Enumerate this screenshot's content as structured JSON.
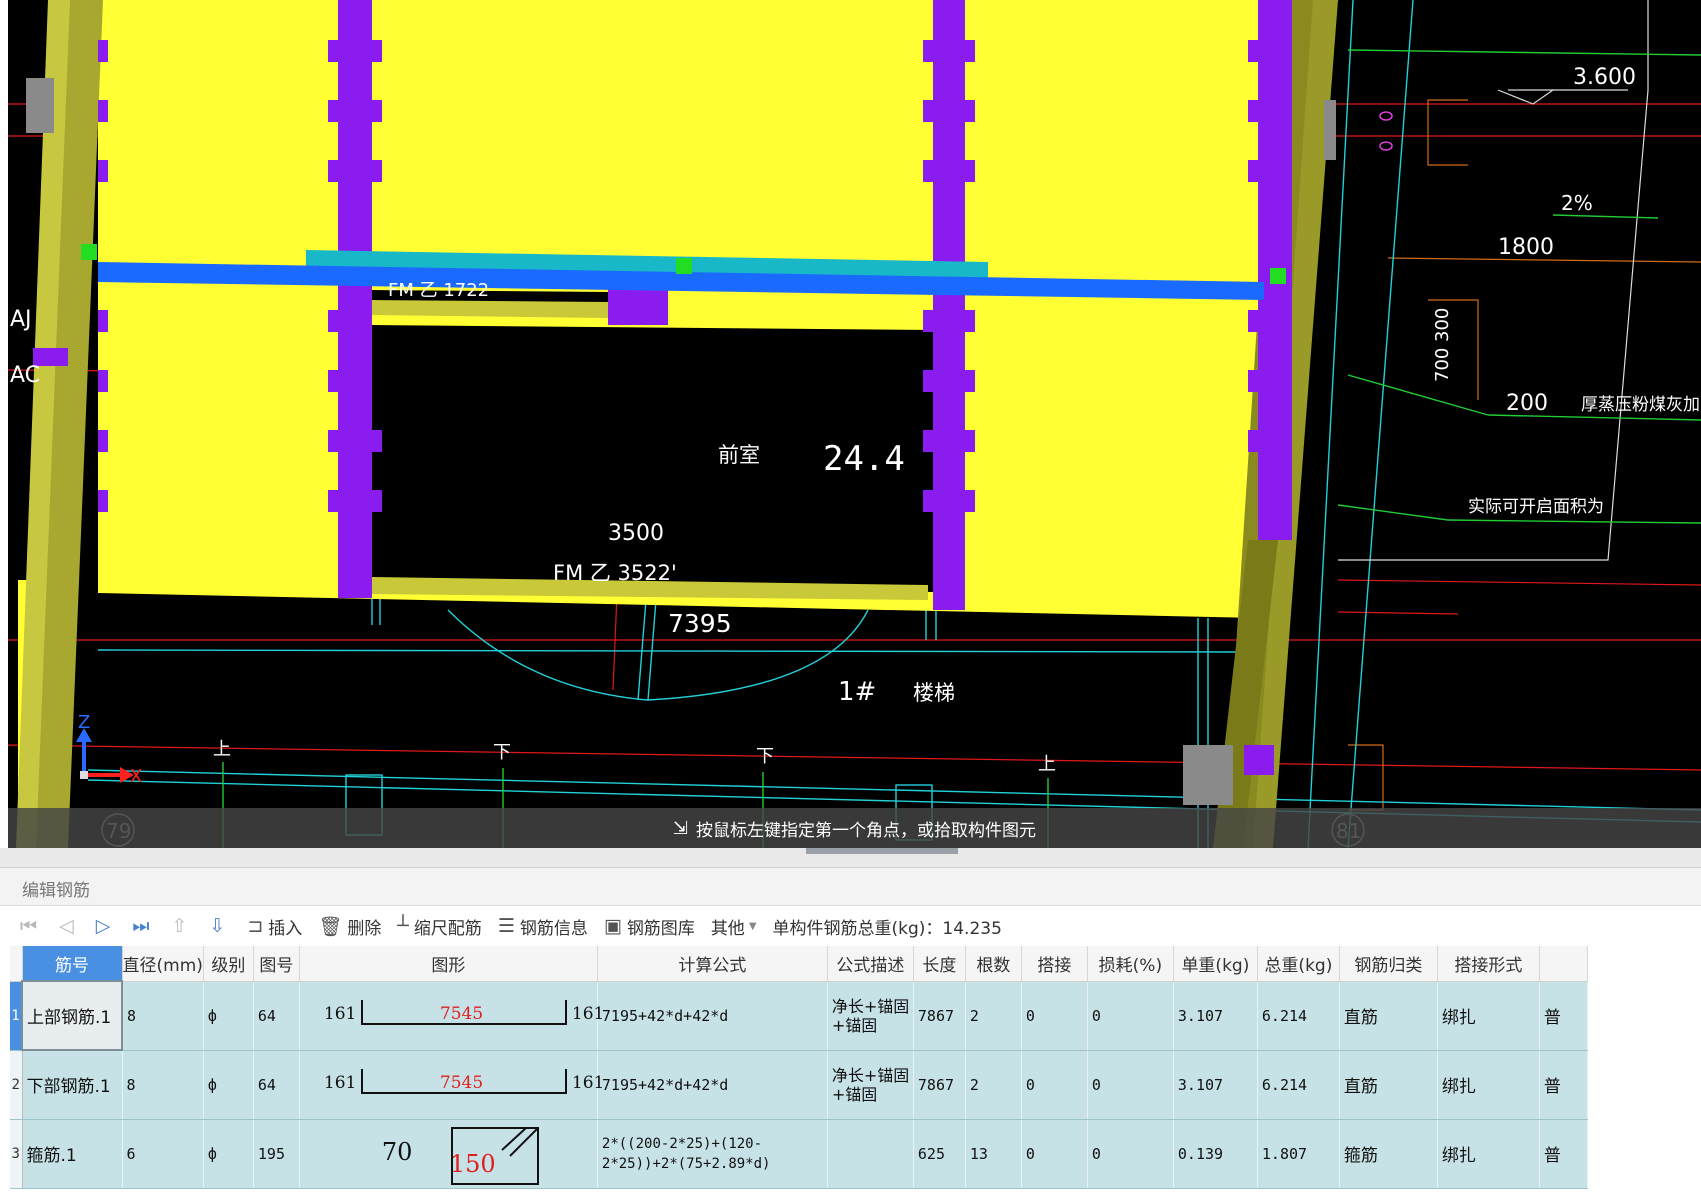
{
  "canvas": {
    "labels": {
      "room": "前室",
      "area": "24.4",
      "dim_3500": "3500",
      "door_upper": "FM 乙 1722",
      "door_lower": "FM 乙 3522'",
      "dim_7395": "7395",
      "stair": "1#",
      "stair_name": "楼梯",
      "elev": "3.600",
      "slope": "2%",
      "dim_1800": "1800",
      "dim_300": "300",
      "dim_700": "700",
      "dim_200": "200",
      "wall_note": "厚蒸压粉煤灰加",
      "open_note": "实际可开启面积为",
      "axis_a": "AJ",
      "axis_b": "AC",
      "up1": "上",
      "down1": "下",
      "down2": "下",
      "up2": "上",
      "grid79": "79",
      "grid81": "81",
      "axis_z": "Z",
      "axis_x": "X"
    },
    "status_text": "按鼠标左键指定第一个角点，或拾取构件图元"
  },
  "panel": {
    "title": "编辑钢筋"
  },
  "toolbar": {
    "insert": "插入",
    "delete": "删除",
    "scale": "缩尺配筋",
    "info": "钢筋信息",
    "library": "钢筋图库",
    "other": "其他",
    "total_label": "单构件钢筋总重(kg)：",
    "total_value": "14.235"
  },
  "table": {
    "headers": {
      "no": "筋号",
      "dia": "直径(mm)",
      "grade": "级别",
      "fig": "图号",
      "shape": "图形",
      "formula": "计算公式",
      "desc": "公式描述",
      "length": "长度",
      "count": "根数",
      "lap": "搭接",
      "loss": "损耗(%)",
      "unit_w": "单重(kg)",
      "total_w": "总重(kg)",
      "category": "钢筋归类",
      "lap_type": "搭接形式"
    },
    "rows": [
      {
        "idx": "1",
        "name": "上部钢筋.1",
        "dia": "8",
        "grade": "ф",
        "fig": "64",
        "shape_left": "161",
        "shape_mid": "7545",
        "shape_right": "161",
        "formula": "7195+42*d+42*d",
        "desc": "净长+锚固+锚固",
        "length": "7867",
        "count": "2",
        "lap": "0",
        "loss": "0",
        "unit_w": "3.107",
        "total_w": "6.214",
        "category": "直筋",
        "lap_type": "绑扎",
        "extra": "普"
      },
      {
        "idx": "2",
        "name": "下部钢筋.1",
        "dia": "8",
        "grade": "ф",
        "fig": "64",
        "shape_left": "161",
        "shape_mid": "7545",
        "shape_right": "161",
        "formula": "7195+42*d+42*d",
        "desc": "净长+锚固+锚固",
        "length": "7867",
        "count": "2",
        "lap": "0",
        "loss": "0",
        "unit_w": "3.107",
        "total_w": "6.214",
        "category": "直筋",
        "lap_type": "绑扎",
        "extra": "普"
      },
      {
        "idx": "3",
        "name": "箍筋.1",
        "dia": "6",
        "grade": "ф",
        "fig": "195",
        "shape_left": "70",
        "shape_mid": "150",
        "shape_right": "",
        "formula": "2*((200-2*25)+(120-2*25))+2*(75+2.89*d)",
        "desc": "",
        "length": "625",
        "count": "13",
        "lap": "0",
        "loss": "0",
        "unit_w": "0.139",
        "total_w": "1.807",
        "category": "箍筋",
        "lap_type": "绑扎",
        "extra": "普"
      }
    ]
  }
}
